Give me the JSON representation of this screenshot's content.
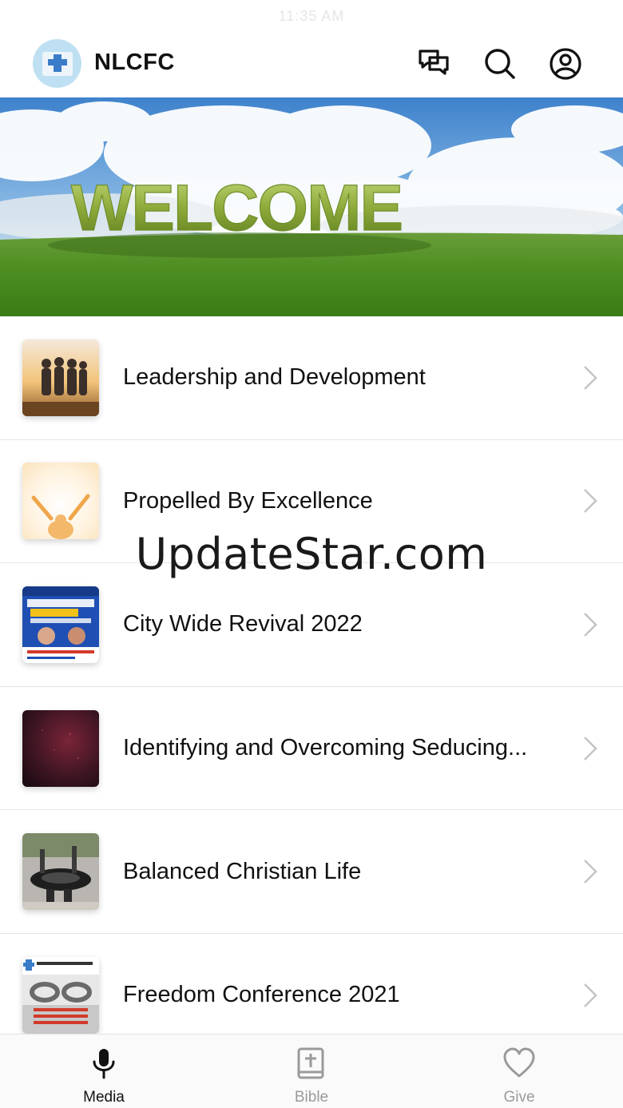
{
  "status_bar": {
    "time": "11:35 AM"
  },
  "header": {
    "title": "NLCFC",
    "logo_icon": "church-logo",
    "actions": [
      {
        "icon": "chat-icon"
      },
      {
        "icon": "search-icon"
      },
      {
        "icon": "account-icon"
      }
    ]
  },
  "hero": {
    "text": "WELCOME"
  },
  "list": {
    "items": [
      {
        "label": "Leadership and Development",
        "thumb": "group-sunset-photo"
      },
      {
        "label": "Propelled By Excellence",
        "thumb": "raised-arms-photo"
      },
      {
        "label": "City Wide Revival 2022",
        "thumb": "revival-flyer"
      },
      {
        "label": "Identifying and Overcoming Seducing...",
        "thumb": "dark-red-texture"
      },
      {
        "label": "Balanced Christian Life",
        "thumb": "tire-swing-photo"
      },
      {
        "label": "Freedom Conference 2021",
        "thumb": "broken-chain-flyer"
      }
    ]
  },
  "watermark": "UpdateStar.com",
  "tabbar": {
    "tabs": [
      {
        "label": "Media",
        "icon": "microphone-icon",
        "active": true
      },
      {
        "label": "Bible",
        "icon": "bible-icon",
        "active": false
      },
      {
        "label": "Give",
        "icon": "heart-icon",
        "active": false
      }
    ]
  },
  "colors": {
    "accent": "#111111",
    "inactive": "#9a9a9a",
    "divider": "#e6e6e6"
  }
}
